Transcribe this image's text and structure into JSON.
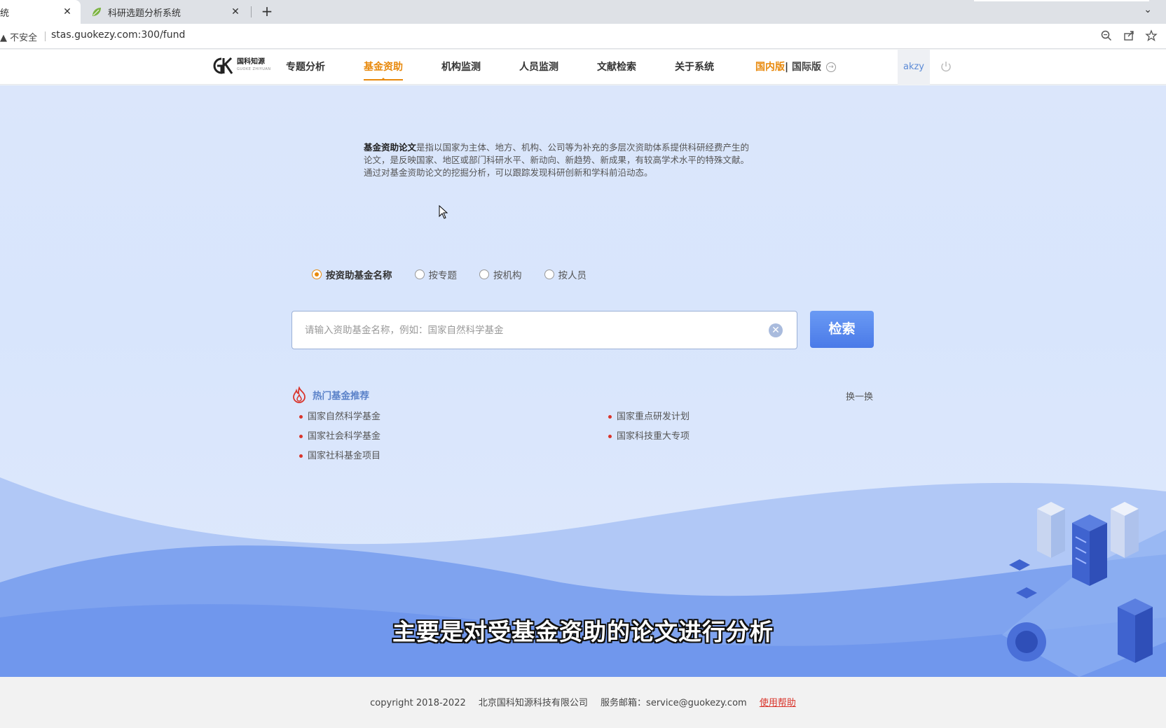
{
  "browser": {
    "tabs": [
      {
        "title": "统",
        "active": true
      },
      {
        "title": "科研选题分析系统",
        "active": false
      }
    ],
    "new_tab_label": "+",
    "close_label": "✕",
    "security_label": "不安全",
    "url": "stas.guokezy.com:300/fund"
  },
  "header": {
    "logo_text": "国科知源",
    "logo_subtext": "GUOKE ZHIYUAN",
    "nav": [
      {
        "label": "专题分析",
        "active": false
      },
      {
        "label": "基金资助",
        "active": true
      },
      {
        "label": "机构监测",
        "active": false
      },
      {
        "label": "人员监测",
        "active": false
      },
      {
        "label": "文献检索",
        "active": false
      },
      {
        "label": "关于系统",
        "active": false
      }
    ],
    "version_domestic": "国内版",
    "version_sep": "|",
    "version_international": "国际版",
    "username": "akzy"
  },
  "intro": {
    "term": "基金资助论文",
    "text": "是指以国家为主体、地方、机构、公司等为补充的多层次资助体系提供科研经费产生的论文，是反映国家、地区或部门科研水平、新动向、新趋势、新成果，有较高学术水平的特殊文献。通过对基金资助论文的挖掘分析，可以跟踪发现科研创新和学科前沿动态。"
  },
  "search": {
    "modes": [
      {
        "label": "按资助基金名称",
        "checked": true
      },
      {
        "label": "按专题",
        "checked": false
      },
      {
        "label": "按机构",
        "checked": false
      },
      {
        "label": "按人员",
        "checked": false
      }
    ],
    "placeholder": "请输入资助基金名称，例如：国家自然科学基金",
    "value": "",
    "button_label": "检索"
  },
  "hot": {
    "title": "热门基金推荐",
    "refresh_label": "换一换",
    "items": [
      "国家自然科学基金",
      "国家重点研发计划",
      "国家社会科学基金",
      "国家科技重大专项",
      "国家社科基金项目"
    ]
  },
  "subtitle": "主要是对受基金资助的论文进行分析",
  "footer": {
    "copyright": "copyright 2018-2022",
    "company": "北京国科知源科技有限公司",
    "email": "服务邮箱：service@guokezy.com",
    "help": "使用帮助"
  },
  "colors": {
    "accent": "#e8890c",
    "button": "#5585ee",
    "bullet": "#d9342b",
    "background": "#dbe6fb"
  }
}
